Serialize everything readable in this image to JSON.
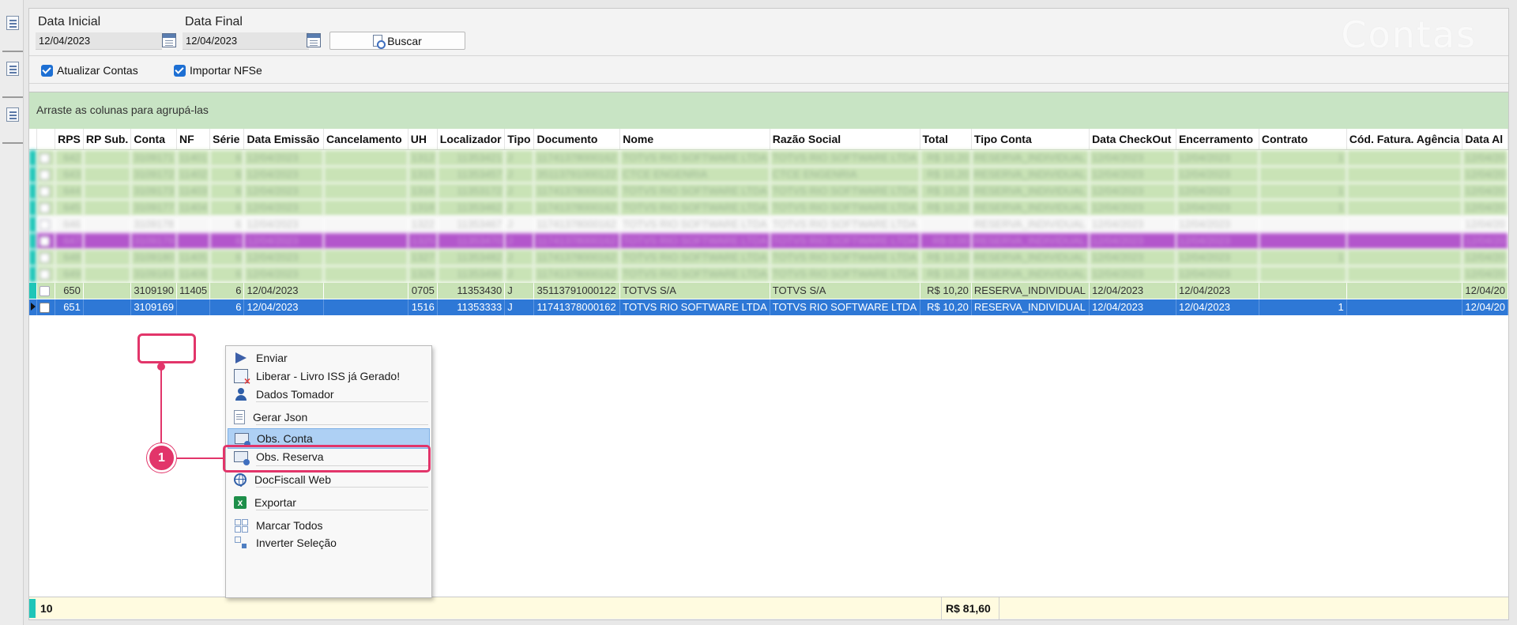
{
  "filters": {
    "data_inicial_label": "Data Inicial",
    "data_inicial_value": "12/04/2023",
    "data_final_label": "Data Final",
    "data_final_value": "12/04/2023",
    "buscar_label": "Buscar",
    "screen_title": "Contas"
  },
  "options": {
    "atualizar_contas": "Atualizar Contas",
    "importar_nfse": "Importar NFSe"
  },
  "grid": {
    "group_hint": "Arraste as colunas para agrupá-las",
    "columns": [
      "RPS",
      "RP Sub.",
      "Conta",
      "NF",
      "Série",
      "Data Emissão",
      "Cancelamento",
      "UH",
      "Localizador",
      "Tipo",
      "Documento",
      "Nome",
      "Razão Social",
      "Total",
      "Tipo Conta",
      "Data CheckOut",
      "Encerramento",
      "Contrato",
      "Cód. Fatura. Agência",
      "Data Al"
    ],
    "rows": [
      {
        "style": "green blur-row",
        "cells": [
          "642",
          "",
          "3109171",
          "11401",
          "6",
          "12/04/2023",
          "",
          "1312",
          "11353421",
          "J",
          "11741378000162",
          "TOTVS RIO SOFTWARE LTDA",
          "TOTVS RIO SOFTWARE LTDA",
          "R$ 10,20",
          "RESERVA_INDIVIDUAL",
          "12/04/2023",
          "12/04/2023",
          "1",
          "",
          "12/04/20"
        ]
      },
      {
        "style": "green blur-row",
        "cells": [
          "643",
          "",
          "3109172",
          "11402",
          "6",
          "12/04/2023",
          "",
          "1315",
          "11353457",
          "J",
          "35113791000122",
          "CTCE ENGENRIA",
          "CTCE ENGENRIA",
          "R$ 10,20",
          "RESERVA_INDIVIDUAL",
          "12/04/2023",
          "12/04/2023",
          "",
          "",
          "12/04/20"
        ]
      },
      {
        "style": "green blur-row",
        "cells": [
          "644",
          "",
          "3109173",
          "11403",
          "6",
          "12/04/2023",
          "",
          "1316",
          "11353172",
          "J",
          "11741378000162",
          "TOTVS RIO SOFTWARE LTDA",
          "TOTVS RIO SOFTWARE LTDA",
          "R$ 10,20",
          "RESERVA_INDIVIDUAL",
          "12/04/2023",
          "12/04/2023",
          "1",
          "",
          "12/04/20"
        ]
      },
      {
        "style": "green blur-row",
        "cells": [
          "645",
          "",
          "3109177",
          "11404",
          "6",
          "12/04/2023",
          "",
          "1318",
          "11353462",
          "J",
          "11741378000162",
          "TOTVS RIO SOFTWARE LTDA",
          "TOTVS RIO SOFTWARE LTDA",
          "R$ 10,20",
          "RESERVA_INDIVIDUAL",
          "12/04/2023",
          "12/04/2023",
          "1",
          "",
          "12/04/20"
        ]
      },
      {
        "style": "white blur-row",
        "cells": [
          "646",
          "",
          "3109178",
          "",
          "6",
          "12/04/2023",
          "",
          "1322",
          "11353467",
          "J",
          "11741378000162",
          "TOTVS RIO SOFTWARE LTDA",
          "TOTVS RIO SOFTWARE LTDA",
          "",
          "RESERVA_INDIVIDUAL",
          "12/04/2023",
          "12/04/2023",
          "",
          "",
          "12/04/20"
        ]
      },
      {
        "style": "purple blur-row",
        "cells": [
          "647",
          "",
          "3109179",
          "",
          "6",
          "12/04/2023",
          "",
          "1325",
          "11353470",
          "J",
          "11741378000162",
          "TOTVS RIO SOFTWARE LTDA",
          "TOTVS RIO SOFTWARE LTDA",
          "R$ 0,00",
          "RESERVA_INDIVIDUAL",
          "12/04/2023",
          "12/04/2023",
          "",
          "",
          "12/04/20"
        ]
      },
      {
        "style": "green blur-row",
        "cells": [
          "648",
          "",
          "3109180",
          "11405",
          "6",
          "12/04/2023",
          "",
          "1327",
          "11353482",
          "J",
          "11741378000162",
          "TOTVS RIO SOFTWARE LTDA",
          "TOTVS RIO SOFTWARE LTDA",
          "R$ 10,20",
          "RESERVA_INDIVIDUAL",
          "12/04/2023",
          "12/04/2023",
          "1",
          "",
          "12/04/20"
        ]
      },
      {
        "style": "green blur-row",
        "cells": [
          "649",
          "",
          "3109183",
          "11406",
          "6",
          "12/04/2023",
          "",
          "1329",
          "11353490",
          "J",
          "11741378000162",
          "TOTVS RIO SOFTWARE LTDA",
          "TOTVS RIO SOFTWARE LTDA",
          "R$ 10,20",
          "RESERVA_INDIVIDUAL",
          "12/04/2023",
          "12/04/2023",
          "",
          "",
          "12/04/20"
        ]
      },
      {
        "style": "green clear",
        "cells": [
          "650",
          "",
          "3109190",
          "11405",
          "6",
          "12/04/2023",
          "",
          "0705",
          "11353430",
          "J",
          "35113791000122",
          "TOTVS S/A",
          "TOTVS S/A",
          "R$ 10,20",
          "RESERVA_INDIVIDUAL",
          "12/04/2023",
          "12/04/2023",
          "",
          "",
          "12/04/20"
        ]
      },
      {
        "style": "selected",
        "cells": [
          "651",
          "",
          "3109169",
          "",
          "6",
          "12/04/2023",
          "",
          "1516",
          "11353333",
          "J",
          "11741378000162",
          "TOTVS RIO SOFTWARE LTDA",
          "TOTVS RIO SOFTWARE LTDA",
          "R$ 10,20",
          "RESERVA_INDIVIDUAL",
          "12/04/2023",
          "12/04/2023",
          "1",
          "",
          "12/04/20"
        ]
      }
    ],
    "summary_count": "10",
    "summary_total": "R$ 81,60"
  },
  "context_menu": {
    "items": [
      {
        "label": "Enviar",
        "icon": "send-icon"
      },
      {
        "label": "Liberar - Livro ISS já Gerado!",
        "icon": "release-icon"
      },
      {
        "label": "Dados Tomador",
        "icon": "user-icon"
      },
      {
        "label": "Gerar Json",
        "icon": "document-icon"
      },
      {
        "label": "Obs. Conta",
        "icon": "note-icon"
      },
      {
        "label": "Obs. Reserva",
        "icon": "note-icon"
      },
      {
        "label": "DocFiscall Web",
        "icon": "globe-icon"
      },
      {
        "label": "Exportar",
        "icon": "excel-icon"
      },
      {
        "label": "Marcar Todos",
        "icon": "select-all-icon"
      },
      {
        "label": "Inverter Seleção",
        "icon": "invert-selection-icon"
      }
    ]
  },
  "annotation": {
    "badge": "1",
    "color": "#e2356a"
  }
}
